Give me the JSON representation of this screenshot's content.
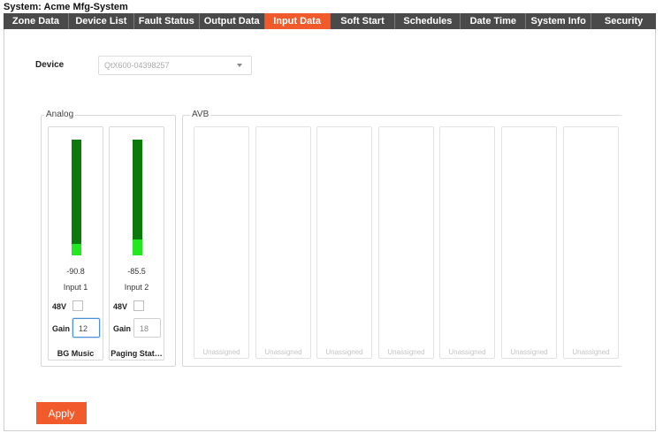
{
  "system": {
    "title": "System: Acme Mfg-System"
  },
  "tabs": [
    {
      "label": "Zone Data"
    },
    {
      "label": "Device List"
    },
    {
      "label": "Fault Status"
    },
    {
      "label": "Output Data"
    },
    {
      "label": "Input Data",
      "active": true
    },
    {
      "label": "Soft Start"
    },
    {
      "label": "Schedules"
    },
    {
      "label": "Date Time"
    },
    {
      "label": "System Info"
    },
    {
      "label": "Security"
    }
  ],
  "device": {
    "label": "Device",
    "value": "QtX600-04398257"
  },
  "analog": {
    "legend": "Analog",
    "channels": [
      {
        "value": "-90.8",
        "name": "Input 1",
        "phantom_label": "48V",
        "phantom_on": false,
        "gain_label": "Gain",
        "gain": "12",
        "label": "BG Music",
        "meter_level": 0.1
      },
      {
        "value": "-85.5",
        "name": "Input 2",
        "phantom_label": "48V",
        "phantom_on": false,
        "gain_label": "Gain",
        "gain": "18",
        "label": "Paging Stat…",
        "meter_level": 0.14
      }
    ]
  },
  "avb": {
    "legend": "AVB",
    "slots": [
      "Unassigned",
      "Unassigned",
      "Unassigned",
      "Unassigned",
      "Unassigned",
      "Unassigned",
      "Unassigned"
    ]
  },
  "apply": {
    "label": "Apply"
  },
  "colors": {
    "accent": "#f15a2b",
    "tab_bg": "#4a4a4a",
    "meter_dark": "#0a7a0a",
    "meter_level": "#22e822"
  }
}
